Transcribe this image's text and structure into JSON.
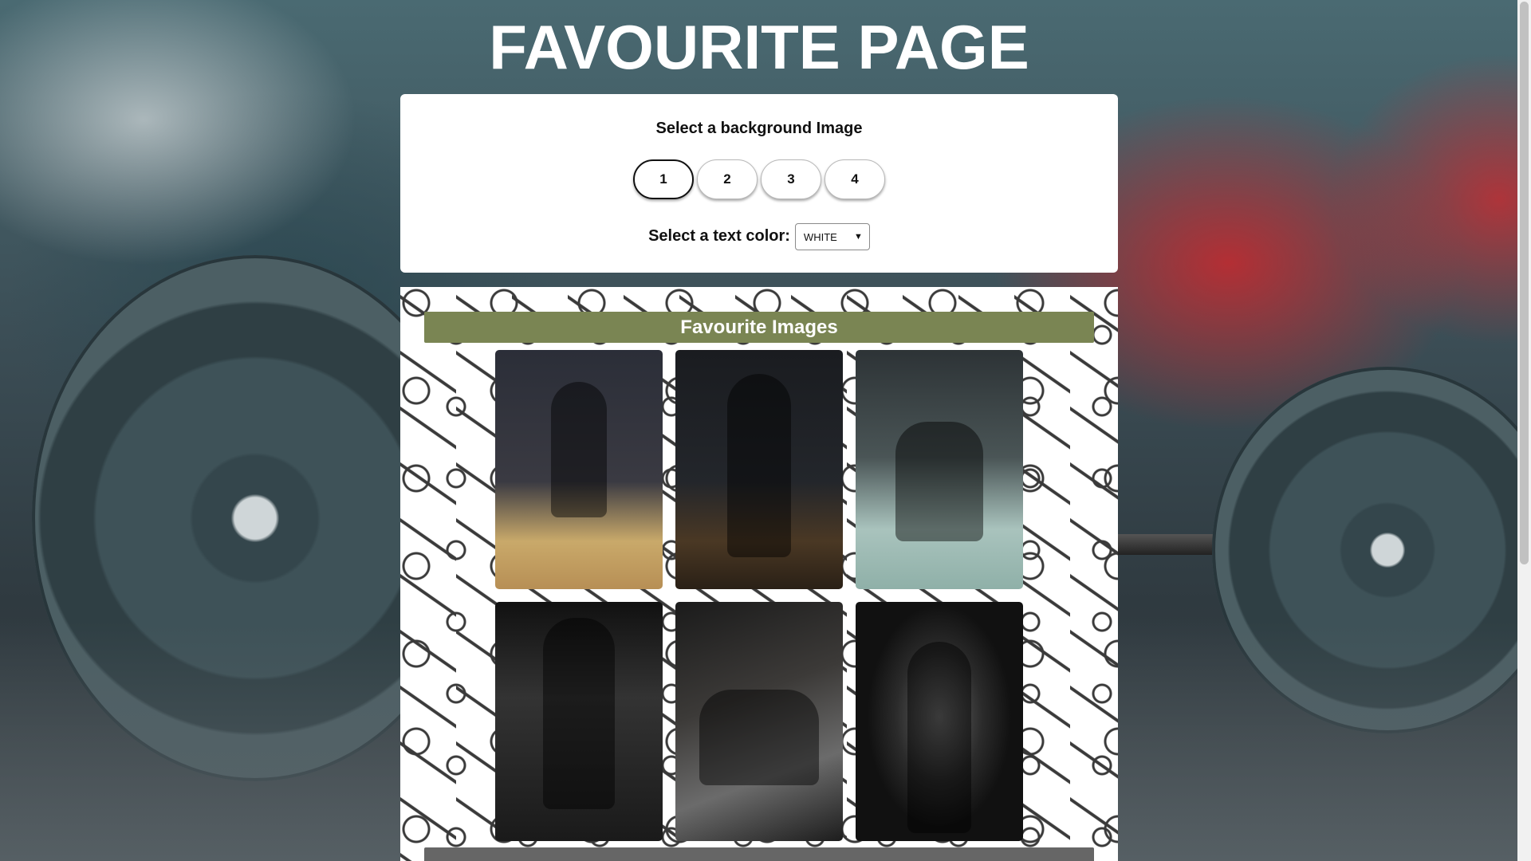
{
  "page": {
    "title": "FAVOURITE PAGE"
  },
  "settings": {
    "heading": "Select a background Image",
    "background_buttons": [
      "1",
      "2",
      "3",
      "4"
    ],
    "active_background": "1",
    "text_color_label": "Select a text color:",
    "text_color_selected": "WHITE"
  },
  "favourites": {
    "heading": "Favourite Images",
    "images": [
      {
        "icon": "photo-box-jump"
      },
      {
        "icon": "photo-mirror-workout"
      },
      {
        "icon": "photo-situp"
      },
      {
        "icon": "photo-pullup"
      },
      {
        "icon": "photo-bench-press"
      },
      {
        "icon": "photo-barbell-curl"
      }
    ]
  },
  "colors": {
    "header_bar": "#7a8553",
    "title_text": "#ffffff"
  }
}
